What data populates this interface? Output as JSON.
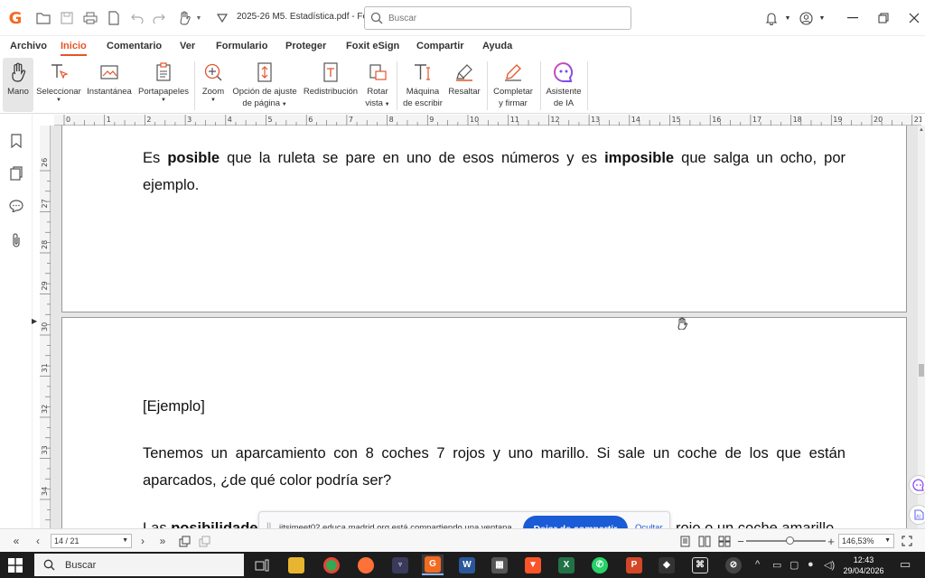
{
  "titlebar": {
    "doc_title": "2025-26 M5. Estadística.pdf - Fo...",
    "search_placeholder": "Buscar"
  },
  "menu": [
    "Archivo",
    "Inicio",
    "Comentario",
    "Ver",
    "Formulario",
    "Proteger",
    "Foxit eSign",
    "Compartir",
    "Ayuda"
  ],
  "menu_active": "Inicio",
  "ribbon": {
    "mano": "Mano",
    "seleccionar": "Seleccionar",
    "instantanea": "Instantánea",
    "portapapeles": "Portapapeles",
    "zoom": "Zoom",
    "ajuste_l1": "Opción de ajuste",
    "ajuste_l2": "de página",
    "redistribucion": "Redistribución",
    "rotar_l1": "Rotar",
    "rotar_l2": "vista",
    "maquina_l1": "Máquina",
    "maquina_l2": "de escribir",
    "resaltar": "Resaltar",
    "completar_l1": "Completar",
    "completar_l2": "y firmar",
    "asistente_l1": "Asistente",
    "asistente_l2": "de IA"
  },
  "ruler": {
    "horizontal": [
      "0",
      "1",
      "2",
      "3",
      "4",
      "5",
      "6",
      "7",
      "8",
      "9",
      "10",
      "11",
      "12",
      "13",
      "14",
      "15",
      "16",
      "17",
      "18",
      "19",
      "20",
      "21"
    ],
    "vertical": [
      "26",
      "27",
      "28",
      "29",
      "30",
      "31",
      "32",
      "33",
      "34"
    ]
  },
  "document": {
    "p1": {
      "a": "Es ",
      "b": "posible",
      "c": " que la ruleta se pare en uno de esos números y es ",
      "d": "imposible",
      "e": " que salga un ocho, por ejemplo."
    },
    "ejemplo": "[Ejemplo]",
    "p2": "Tenemos un aparcamiento con 8 coches 7 rojos y uno marillo. Si sale un coche de los que están aparcados, ¿de qué color podría ser?",
    "p3_start": "Las ",
    "p3_bold": "posibilidades",
    "p3_end": "rojo o un coche amarillo."
  },
  "share_banner": {
    "message": "jitsimeet02.educa.madrid.org está compartiendo una ventana.",
    "stop_button": "Dejar de compartir",
    "hide_link": "Ocultar"
  },
  "statusbar": {
    "page": "14 / 21",
    "zoom": "146,53%",
    "zoom_fraction": 0.55
  },
  "taskbar": {
    "search": "Buscar",
    "time": "12:43",
    "date": "29/04/2026"
  },
  "colors": {
    "accent": "#e5542b",
    "share_button": "#1a5bd6",
    "taskbar": "#1d1d1d"
  }
}
